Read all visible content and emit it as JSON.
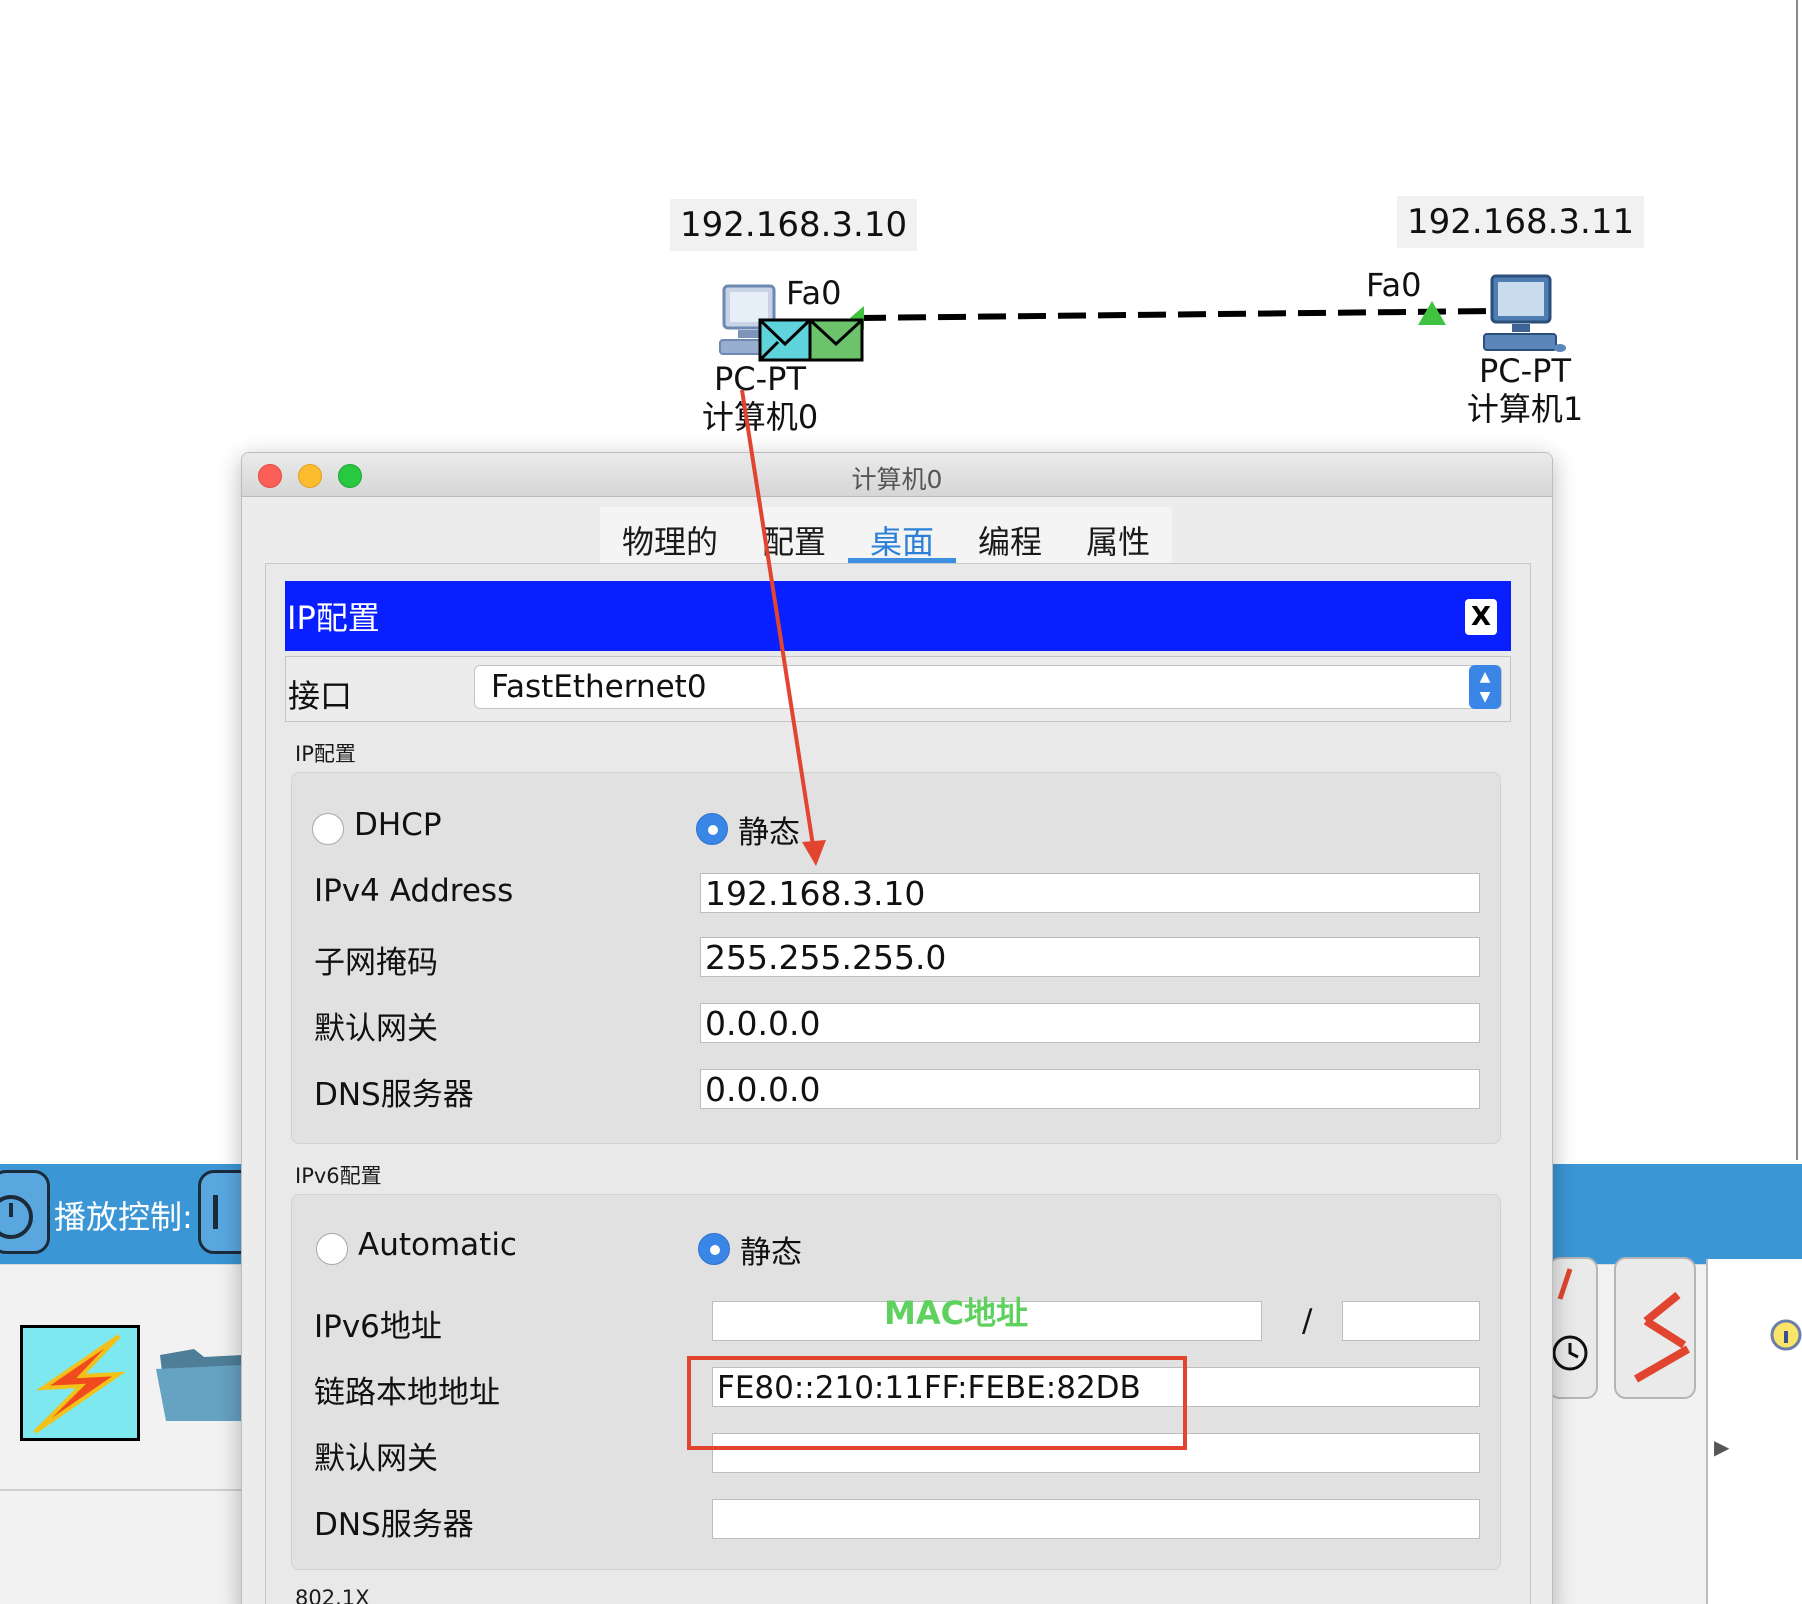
{
  "topology": {
    "pc0": {
      "ip": "192.168.3.10",
      "port": "Fa0",
      "model": "PC-PT",
      "name": "计算机0"
    },
    "pc1": {
      "ip": "192.168.3.11",
      "port": "Fa0",
      "model": "PC-PT",
      "name": "计算机1"
    },
    "link_style": "dashed",
    "pdu_colors": [
      "#5fd3dc",
      "#6cc36c"
    ]
  },
  "background_app": {
    "playback_label": "播放控制:"
  },
  "window": {
    "title": "计算机0",
    "tabs": [
      {
        "label": "物理的",
        "active": false
      },
      {
        "label": "配置",
        "active": false
      },
      {
        "label": "桌面",
        "active": true
      },
      {
        "label": "编程",
        "active": false
      },
      {
        "label": "属性",
        "active": false
      }
    ],
    "panel_title": "IP配置",
    "close_label": "X",
    "interface_label": "接口",
    "interface_value": "FastEthernet0",
    "ipv4_group": {
      "title": "IP配置",
      "dhcp_label": "DHCP",
      "static_label": "静态",
      "mode": "静态",
      "fields": [
        {
          "label": "IPv4 Address",
          "value": "192.168.3.10"
        },
        {
          "label": "子网掩码",
          "value": "255.255.255.0"
        },
        {
          "label": "默认网关",
          "value": "0.0.0.0"
        },
        {
          "label": "DNS服务器",
          "value": "0.0.0.0"
        }
      ]
    },
    "ipv6_group": {
      "title": "IPv6配置",
      "auto_label": "Automatic",
      "static_label": "静态",
      "mode": "静态",
      "address_label": "IPv6地址",
      "address_value": "",
      "prefix_separator": "/",
      "prefix_value": "",
      "link_local_label": "链路本地地址",
      "link_local_value": "FE80::210:11FF:FEBE:82DB",
      "gateway_label": "默认网关",
      "gateway_value": "",
      "dns_label": "DNS服务器",
      "dns_value": ""
    },
    "dot1x_title": "802.1X"
  },
  "annotations": {
    "mac_label": "MAC地址",
    "arrow_color": "#e2452f",
    "box_color": "#e2452f",
    "mac_label_color": "#5fd15f"
  },
  "colors": {
    "panel_header": "#0a1fff",
    "accent": "#3a86e6",
    "toolbar": "#3b96d6"
  }
}
